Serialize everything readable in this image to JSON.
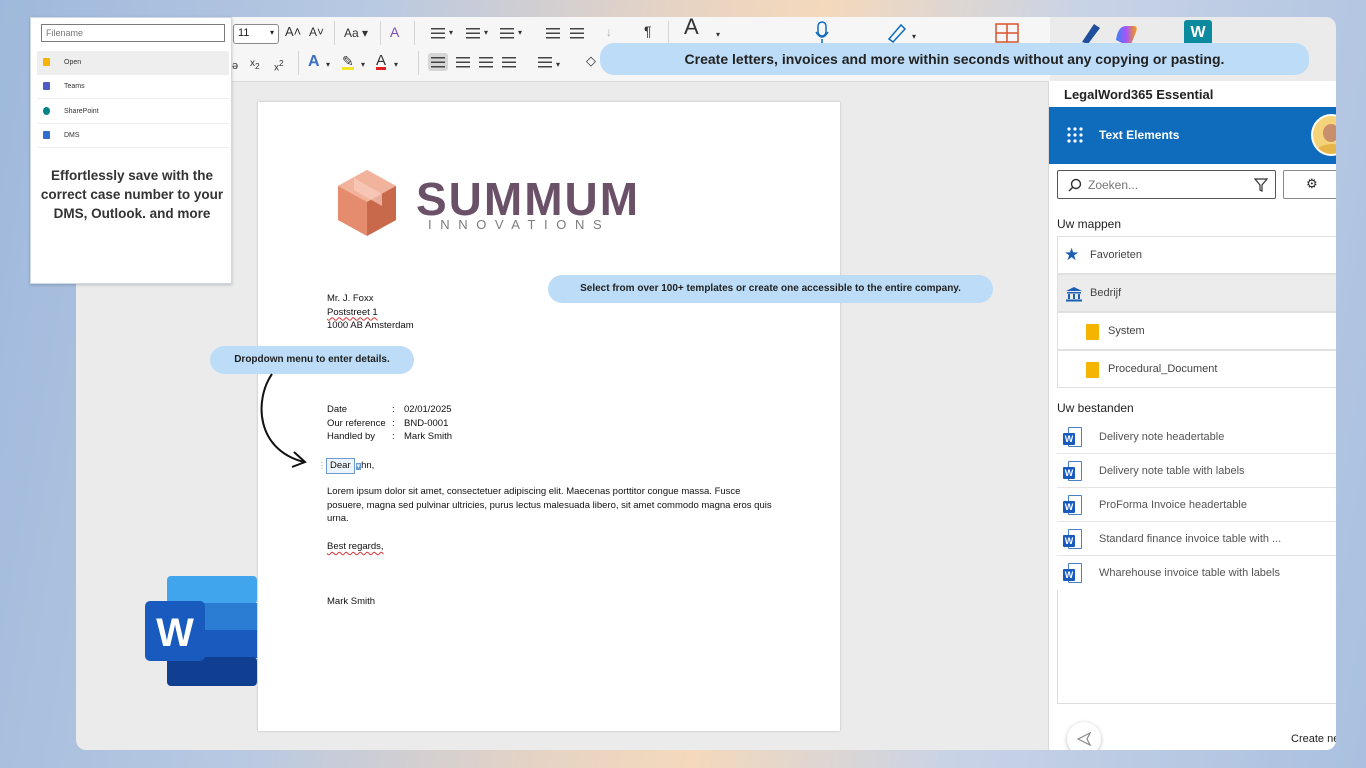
{
  "ribbon": {
    "font_size": "11",
    "case_label": "Aa"
  },
  "filename_popup": {
    "placeholder": "Filename",
    "items": [
      {
        "label": "Open"
      },
      {
        "label": "Teams"
      },
      {
        "label": "SharePoint"
      },
      {
        "label": "DMS"
      }
    ],
    "description": "Effortlessly save with the correct case number to your DMS, Outlook. and more"
  },
  "callouts": {
    "top": "Create letters, invoices and more within seconds without any copying or pasting.",
    "templates": "Select from over 100+  templates or create one accessible to the entire company.",
    "dropdown": "Dropdown menu to enter  details."
  },
  "document": {
    "logo_name": "SUMMUM",
    "logo_sub": "INNOVATIONS",
    "address": [
      "Mr. J. Foxx",
      "Poststreet 1",
      "1000 AB Amsterdam"
    ],
    "fields": [
      {
        "label": "Date",
        "sep": ":",
        "value": "02/01/2025"
      },
      {
        "label": "Our reference",
        "sep": ":",
        "value": "BND-0001"
      },
      {
        "label": "Handled by",
        "sep": ":",
        "value": "Mark Smith"
      }
    ],
    "salutation_control": "Dear",
    "salutation_rest": "hn,",
    "body": "Lorem ipsum dolor sit amet, consectetuer adipiscing elit. Maecenas porttitor congue massa. Fusce posuere, magna sed pulvinar ultricies, purus lectus malesuada libero, sit amet commodo magna eros quis urna.",
    "closing": "Best regards,",
    "signature": "Mark Smith"
  },
  "panel": {
    "title": "LegalWord365 Essential",
    "header": "Text Elements",
    "search_placeholder": "Zoeken...",
    "folders_heading": "Uw mappen",
    "folders": [
      {
        "label": "Favorieten",
        "icon": "star-icon"
      },
      {
        "label": "Bedrijf",
        "icon": "bank-icon"
      },
      {
        "label": "System",
        "icon": "folder-icon"
      },
      {
        "label": "Procedural_Document",
        "icon": "folder-icon"
      }
    ],
    "files_heading": "Uw bestanden",
    "files": [
      {
        "label": "Delivery note headertable"
      },
      {
        "label": "Delivery note table with labels"
      },
      {
        "label": "ProForma Invoice headertable"
      },
      {
        "label": "Standard finance invoice table with ..."
      },
      {
        "label": "Wharehouse invoice table with labels"
      }
    ],
    "create_label": "Create ne"
  },
  "colors": {
    "accent_blue": "#0f6cbd",
    "callout_bg": "#bcdcf7",
    "logo_orange": "#e58c6e",
    "logo_purple": "#6a5168"
  }
}
